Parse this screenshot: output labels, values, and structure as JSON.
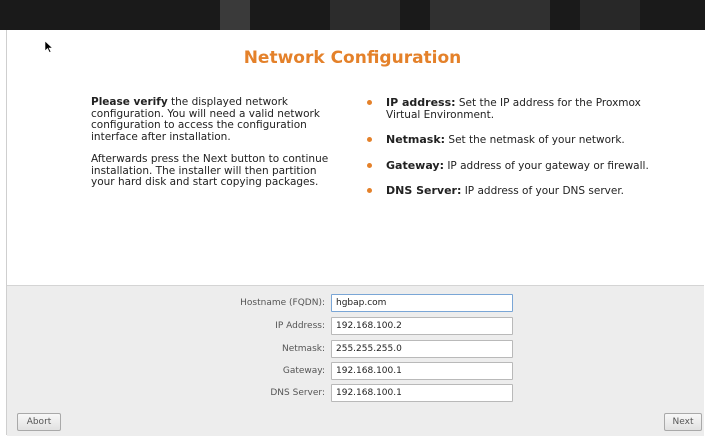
{
  "title": "Network Configuration",
  "intro": {
    "para1_bold": "Please verify",
    "para1_rest": " the displayed network configuration. You will need a valid network configuration to access the configuration interface after installation.",
    "para2": "Afterwards press the Next button to continue installation. The installer will then partition your hard disk and start copying packages."
  },
  "help_items": [
    {
      "term": "IP address:",
      "desc": " Set the IP address for the Proxmox Virtual Environment."
    },
    {
      "term": "Netmask:",
      "desc": " Set the netmask of your network."
    },
    {
      "term": "Gateway:",
      "desc": " IP address of your gateway or firewall."
    },
    {
      "term": "DNS Server:",
      "desc": " IP address of your DNS server."
    }
  ],
  "form": {
    "hostname": {
      "label": "Hostname (FQDN):",
      "value": "hgbap.com"
    },
    "ip": {
      "label": "IP Address:",
      "value": "192.168.100.2"
    },
    "netmask": {
      "label": "Netmask:",
      "value": "255.255.255.0"
    },
    "gateway": {
      "label": "Gateway:",
      "value": "192.168.100.1"
    },
    "dns": {
      "label": "DNS Server:",
      "value": "192.168.100.1"
    }
  },
  "buttons": {
    "abort": "Abort",
    "next": "Next"
  },
  "colors": {
    "accent": "#e4812a"
  }
}
